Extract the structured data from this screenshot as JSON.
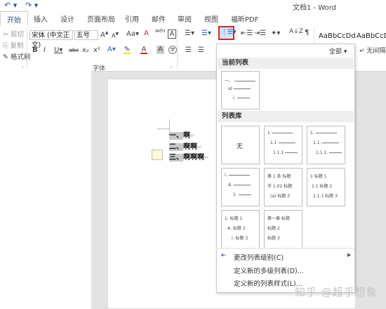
{
  "titlebar": {
    "undo_icon": "undo-icon",
    "redo_icon": "redo-icon",
    "title": "文档1 - Word"
  },
  "tabs": [
    "开始",
    "插入",
    "设计",
    "页面布局",
    "引用",
    "邮件",
    "审阅",
    "视图",
    "福昕PDF"
  ],
  "clipboard": {
    "cut": "剪切",
    "copy": "复制",
    "format_painter": "格式刷"
  },
  "font": {
    "name": "宋体 (中文正文)",
    "size": "五号",
    "group_label": "字体",
    "bold": "B",
    "italic": "I",
    "underline": "U",
    "strike": "abc",
    "sub": "x₂",
    "sup": "x²",
    "grow": "A",
    "shrink": "A",
    "case": "Aa",
    "clear": "A",
    "phonetic": "wén",
    "charbox": "A",
    "effects": "A",
    "color_a": "A",
    "shade": "A"
  },
  "styles": {
    "sample1": "AaBbCcDd",
    "sample2": "AaBbCcDd",
    "no_spacing": "↵ 无间隔"
  },
  "document": {
    "lines": [
      {
        "num": "一、",
        "text": "啊"
      },
      {
        "num": "二、",
        "text": "啊啊"
      },
      {
        "num": "三、",
        "text": "啊啊啊"
      }
    ],
    "para_mark": "↵"
  },
  "dropdown": {
    "filter": "全部 ▾",
    "current_header": "当前列表",
    "library_header": "列表库",
    "none_label": "无",
    "current_tile": [
      "一、",
      "a)",
      "i."
    ],
    "tiles": [
      [
        "1",
        "1.1",
        "1.1.1"
      ],
      [
        "1.",
        "1.1.",
        "1.1.1."
      ],
      [
        "i.",
        "A.",
        "1."
      ],
      [
        "第 1 条 标题",
        "节 1.01 标题",
        "(a) 标题 3"
      ],
      [
        "1 标题 1",
        "1.1 标题 2",
        "1.1.1 标题 3"
      ],
      [
        "1. 标题 1",
        "A. 标题 2",
        "i. 标题 3"
      ],
      [
        "第一章 标题",
        "标题 2",
        "标题 3"
      ]
    ],
    "menu": [
      "更改列表级别(C)",
      "定义新的多级列表(D)...",
      "定义新的列表样式(L)..."
    ]
  },
  "watermark": "知乎 @超乎想象"
}
